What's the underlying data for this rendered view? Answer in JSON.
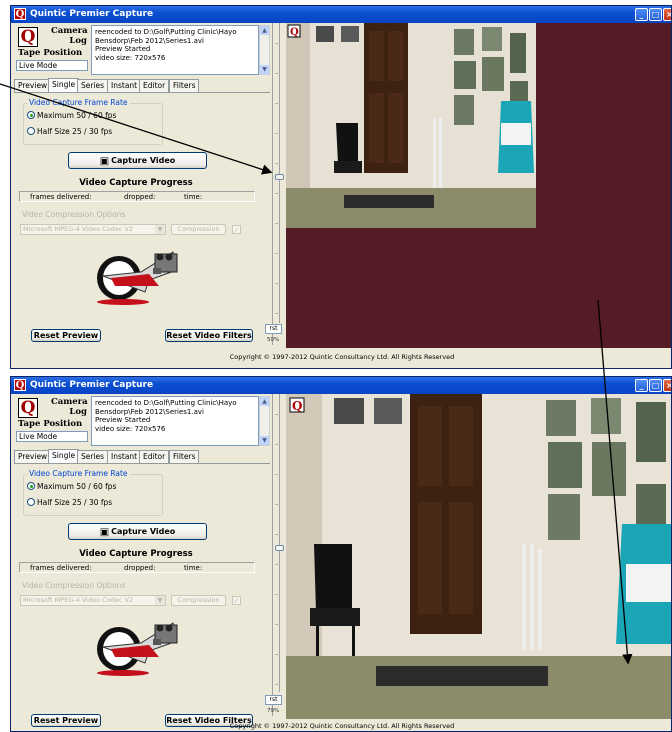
{
  "app": {
    "title": "Quintic Premier Capture",
    "logo_letter": "Q"
  },
  "left": {
    "camera_label": "Camera",
    "log_label": "Log",
    "tape_label": "Tape Position",
    "tape_value": "Live Mode",
    "log_lines": [
      "reencoded to D:\\Golf\\Putting Clinic\\Hayo",
      "Bensdorp\\Feb 2012\\Series1.avi",
      "Preview Started",
      "video size: 720x576"
    ],
    "tabs": [
      "Preview",
      "Single",
      "Series",
      "Instant",
      "Editor",
      "Filters"
    ],
    "active_tab": "Single",
    "frame_rate_group": "Video Capture Frame Rate",
    "radio_max": "Maximum  50 / 60 fps",
    "radio_half": "Half Size  25 / 30 fps",
    "capture_button": "Capture Video",
    "progress_title": "Video Capture Progress",
    "frames_delivered": "frames delivered:",
    "dropped": "dropped:",
    "time": "time:",
    "compression_group": "Video Compression Options",
    "codec": "Microsoft MPEG-4 Video Codec V2",
    "compression_button": "Compression",
    "reset_preview": "Reset Preview",
    "reset_filters": "Reset Video Filters"
  },
  "windows": [
    {
      "zoom": "50%",
      "rst": "rst"
    },
    {
      "zoom": "79%",
      "rst": "rst"
    }
  ],
  "status": {
    "copyright": "Copyright © 1997-2012  Quintic Consultancy Ltd.   All Rights Reserved"
  },
  "colors": {
    "title": "#0a4fd0",
    "video_bg": "#541c24",
    "accent": "#0046d5"
  }
}
